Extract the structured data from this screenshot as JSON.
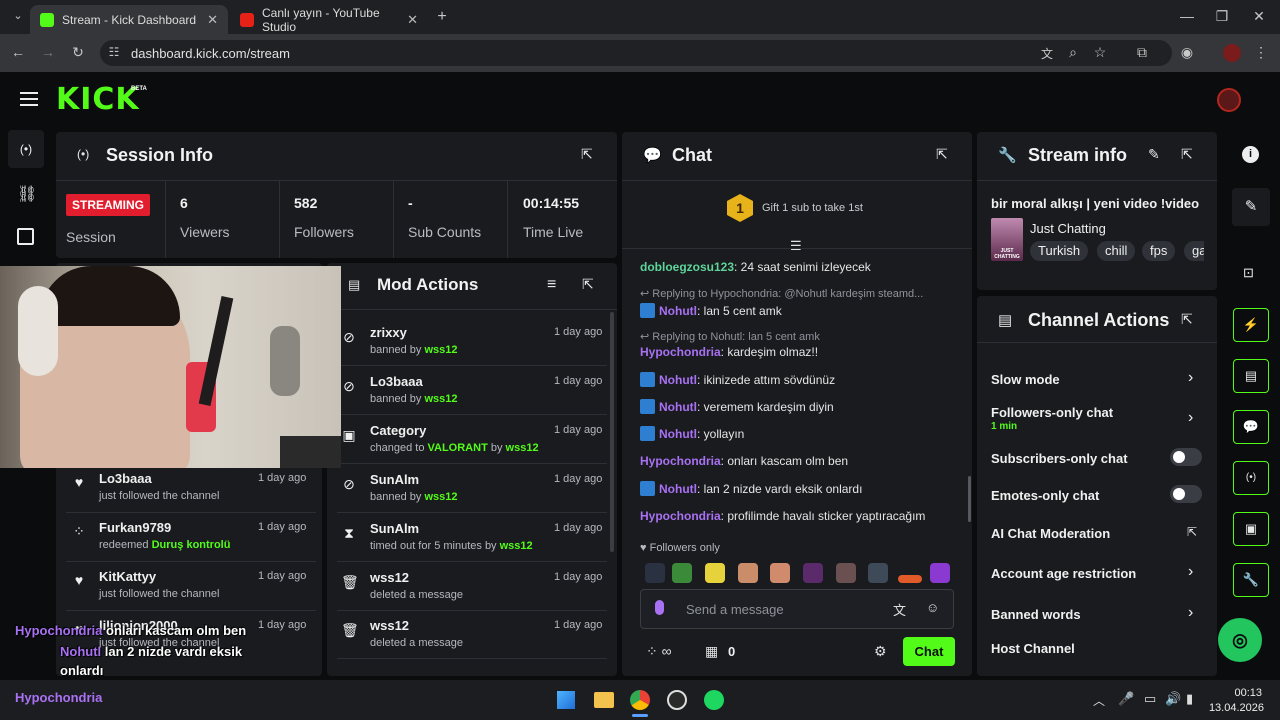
{
  "browser": {
    "tabs": [
      {
        "title": "Stream - Kick Dashboard",
        "active": true
      },
      {
        "title": "Canlı yayın - YouTube Studio",
        "active": false
      }
    ],
    "url": "dashboard.kick.com/stream"
  },
  "kick": {
    "logo": "KICK",
    "beta": "BETA"
  },
  "session": {
    "title": "Session Info",
    "status": "STREAMING",
    "status_label": "Session",
    "stats": [
      {
        "value": "6",
        "label": "Viewers"
      },
      {
        "value": "582",
        "label": "Followers"
      },
      {
        "value": "-",
        "label": "Sub Counts"
      },
      {
        "value": "00:14:55",
        "label": "Time Live"
      }
    ]
  },
  "activity": [
    {
      "name": "Lo3baaa",
      "sub": "just followed the channel",
      "time": "1 day ago",
      "icon": "heart-icon"
    },
    {
      "name": "Furkan9789",
      "sub_prefix": "redeemed",
      "sub_highlight": "Duruş kontrolü",
      "time": "1 day ago",
      "icon": "points-icon"
    },
    {
      "name": "KitKattyy",
      "sub": "just followed the channel",
      "time": "1 day ago",
      "icon": "heart-icon"
    },
    {
      "name": "lilionion2000",
      "sub": "just followed the channel",
      "time": "1 day ago",
      "icon": "heart-icon"
    }
  ],
  "mod_actions": {
    "title": "Mod Actions",
    "items": [
      {
        "name": "zrixxy",
        "sub_prefix": "banned by",
        "by": "wss12",
        "time": "1 day ago",
        "icon": "ban-icon"
      },
      {
        "name": "Lo3baaa",
        "sub_prefix": "banned by",
        "by": "wss12",
        "time": "1 day ago",
        "icon": "ban-icon"
      },
      {
        "name": "Category",
        "sub_prefix": "changed to",
        "highlight": "VALORANT",
        "sub_mid": "by",
        "by": "wss12",
        "time": "1 day ago",
        "icon": "category-icon"
      },
      {
        "name": "SunAlm",
        "sub_prefix": "banned by",
        "by": "wss12",
        "time": "1 day ago",
        "icon": "ban-icon"
      },
      {
        "name": "SunAlm",
        "sub_prefix": "timed out for 5 minutes by",
        "by": "wss12",
        "time": "1 day ago",
        "icon": "hourglass-icon"
      },
      {
        "name": "wss12",
        "sub": "deleted a message",
        "time": "1 day ago",
        "icon": "trash-icon"
      },
      {
        "name": "wss12",
        "sub": "deleted a message",
        "time": "1 day ago",
        "icon": "trash-icon"
      }
    ]
  },
  "chat": {
    "title": "Chat",
    "gift_rank": "1",
    "gift_text": "Gift 1 sub to take 1st",
    "messages": [
      {
        "user": "dobloegzosu123",
        "text": ": 24 saat senimi izleyecek",
        "color": "green"
      },
      {
        "reply": "Replying to Hypochondria: @Nohutl kardeşim steamd..."
      },
      {
        "user": "Nohutl",
        "text": ": lan 5 cent amk",
        "color": "purple",
        "badge": true
      },
      {
        "reply": "Replying to Nohutl: lan 5 cent amk"
      },
      {
        "user": "Hypochondria",
        "text": ": kardeşim olmaz!!",
        "color": "purple"
      },
      {
        "user": "Nohutl",
        "text": ": ikinizede attım sövdünüz",
        "color": "purple",
        "badge": true
      },
      {
        "user": "Nohutl",
        "text": ": veremem kardeşim diyin",
        "color": "purple",
        "badge": true
      },
      {
        "user": "Nohutl",
        "text": ": yollayın",
        "color": "purple",
        "badge": true
      },
      {
        "user": "Hypochondria",
        "text": ": onları kascam olm ben",
        "color": "purple"
      },
      {
        "user": "Nohutl",
        "text": ": lan 2 nizde vardı eksik onlardı",
        "color": "purple",
        "badge": true
      },
      {
        "user": "Hypochondria",
        "text": ": profilimde havalı sticker yaptıracağım",
        "color": "purple"
      }
    ],
    "mode": "Followers only",
    "placeholder": "Send a message",
    "points": "0",
    "send_label": "Chat"
  },
  "stream_info": {
    "title": "Stream info",
    "stream_title": "bir moral alkışı | yeni video !video",
    "category": "Just Chatting",
    "thumb_text": "JUST CHATTING",
    "tags": [
      "Turkish",
      "chill",
      "fps",
      "ga"
    ]
  },
  "channel_actions": {
    "title": "Channel Actions",
    "items": [
      {
        "label": "Slow mode",
        "control": "chevron"
      },
      {
        "label": "Followers-only chat",
        "sub": "1 min",
        "control": "chevron"
      },
      {
        "label": "Subscribers-only chat",
        "control": "toggle"
      },
      {
        "label": "Emotes-only chat",
        "control": "toggle"
      },
      {
        "label": "AI Chat Moderation",
        "control": "external"
      },
      {
        "label": "Account age restriction",
        "control": "chevron"
      },
      {
        "label": "Banned words",
        "control": "chevron"
      },
      {
        "label": "Host Channel",
        "control": "none"
      }
    ]
  },
  "overlay": {
    "lines": [
      {
        "user": "Hypochondria",
        "text": "onları kascam olm ben"
      },
      {
        "user": "Nohutl",
        "text": "lan 2 nizde vardı eksik onlardı"
      }
    ],
    "footer_user": "Hypochondria"
  },
  "taskbar": {
    "time": "00:13",
    "date": "13.04.2026"
  },
  "colors": {
    "accent": "#53fc18",
    "panel": "#191b1f",
    "streaming_badge": "#e11d2e",
    "purple_user": "#a971f3"
  }
}
